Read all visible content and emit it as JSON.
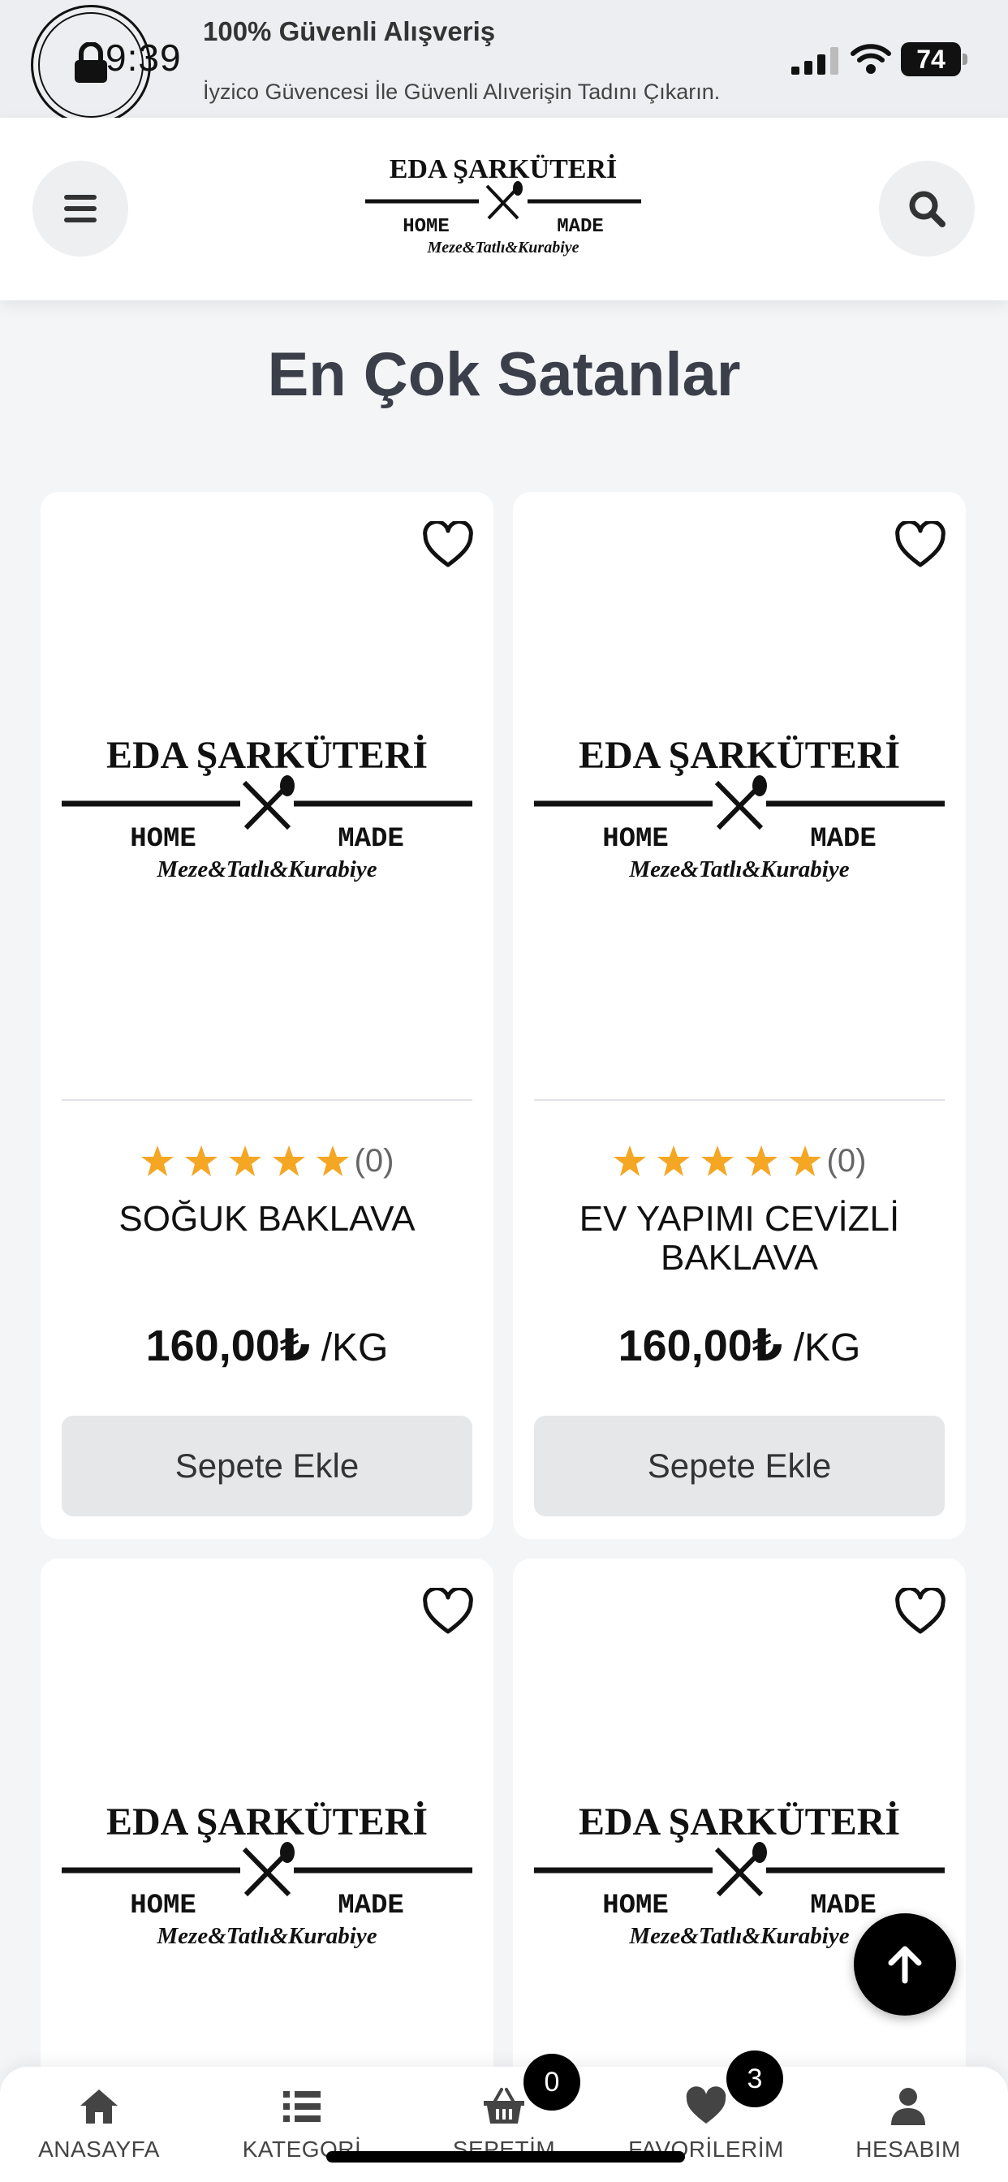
{
  "status_bar": {
    "time": "9:39",
    "battery_level": "74",
    "notification_title": "100% Güvenli Alışveriş",
    "notification_subtitle": "İyzico Güvencesi İle Güvenli Alıverişin Tadını Çıkarın."
  },
  "header": {
    "logo": {
      "name": "EDA ŞARKÜTERİ",
      "left": "HOME",
      "right": "MADE",
      "tagline": "Meze&Tatlı&Kurabiye"
    }
  },
  "section_title": "En Çok Satanlar",
  "products": [
    {
      "name": "SOĞUK BAKLAVA",
      "rating_count": "(0)",
      "price": "160,00₺",
      "unit": " /KG",
      "button": "Sepete Ekle"
    },
    {
      "name": "EV YAPIMI CEVİZLİ BAKLAVA",
      "rating_count": "(0)",
      "price": "160,00₺",
      "unit": " /KG",
      "button": "Sepete Ekle"
    },
    {
      "name": "",
      "rating_count": "",
      "price": "",
      "unit": "",
      "button": ""
    },
    {
      "name": "",
      "rating_count": "",
      "price": "",
      "unit": "",
      "button": ""
    }
  ],
  "bottom_nav": {
    "items": [
      {
        "label": "ANASAYFA",
        "icon": "home-icon"
      },
      {
        "label": "KATEGORİ",
        "icon": "list-icon"
      },
      {
        "label": "SEPETİM",
        "icon": "basket-icon"
      },
      {
        "label": "FAVORİLERİM",
        "icon": "heart-icon"
      },
      {
        "label": "HESABIM",
        "icon": "user-icon"
      }
    ],
    "cart_count": "0",
    "favorites_count": "3"
  },
  "colors": {
    "star": "#f5a623",
    "accent": "#000000",
    "page_background": "#f4f5f7",
    "button_background": "#e6e7e9"
  }
}
